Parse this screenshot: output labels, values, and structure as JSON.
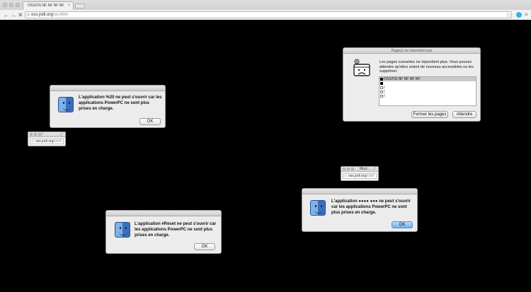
{
  "browser": {
    "tab_title": "OSS/OS NF NF NF NF",
    "tab_close": "×",
    "url_host": "oss.jodi.org",
    "url_path": "/os.html",
    "back_icon": "←",
    "forward_icon": "→",
    "reload_icon": "✕",
    "star_icon": "☆",
    "menu_icon": "≡",
    "globe_icon": "◎"
  },
  "dialogs": [
    {
      "message": "L'application %20 ne peut s'ouvrir car les applications PowerPC ne sont plus prises en charge.",
      "ok_label": "OK"
    },
    {
      "message": "L'application #Reset ne peut s'ouvrir car les applications PowerPC ne sont plus prises en charge.",
      "ok_label": "OK"
    },
    {
      "message": "L'application  ●●●● ●●● ne peut s'ouvrir car les applications PowerPC ne sont plus prises en charge.",
      "ok_label": "OK"
    }
  ],
  "mini_windows": [
    {
      "title": "/",
      "url_host": "oss.jodi.org",
      "url_path": "/os3c",
      "resize_icon": "⤢"
    },
    {
      "title": "Muzi…",
      "url_host": "oss.jodi.org",
      "url_path": "/os5t",
      "resize_icon": "⤢"
    }
  ],
  "unresponsive": {
    "title": "Page(s) ne répondant pas",
    "message": "Les pages suivantes ne répondent plus. Vous pouvez attendre qu'elles soient de nouveau accessibles ou les supprimer.",
    "pages": [
      "OSS/OS NF NF NF NF",
      "",
      "/",
      "/",
      "/"
    ],
    "close_pages_label": "Fermer les pages",
    "wait_label": "Attendre"
  },
  "colors": {
    "desktop_background": "#000000",
    "default_button": "#6fb0ee",
    "extension_icon": "#33b5e5"
  }
}
